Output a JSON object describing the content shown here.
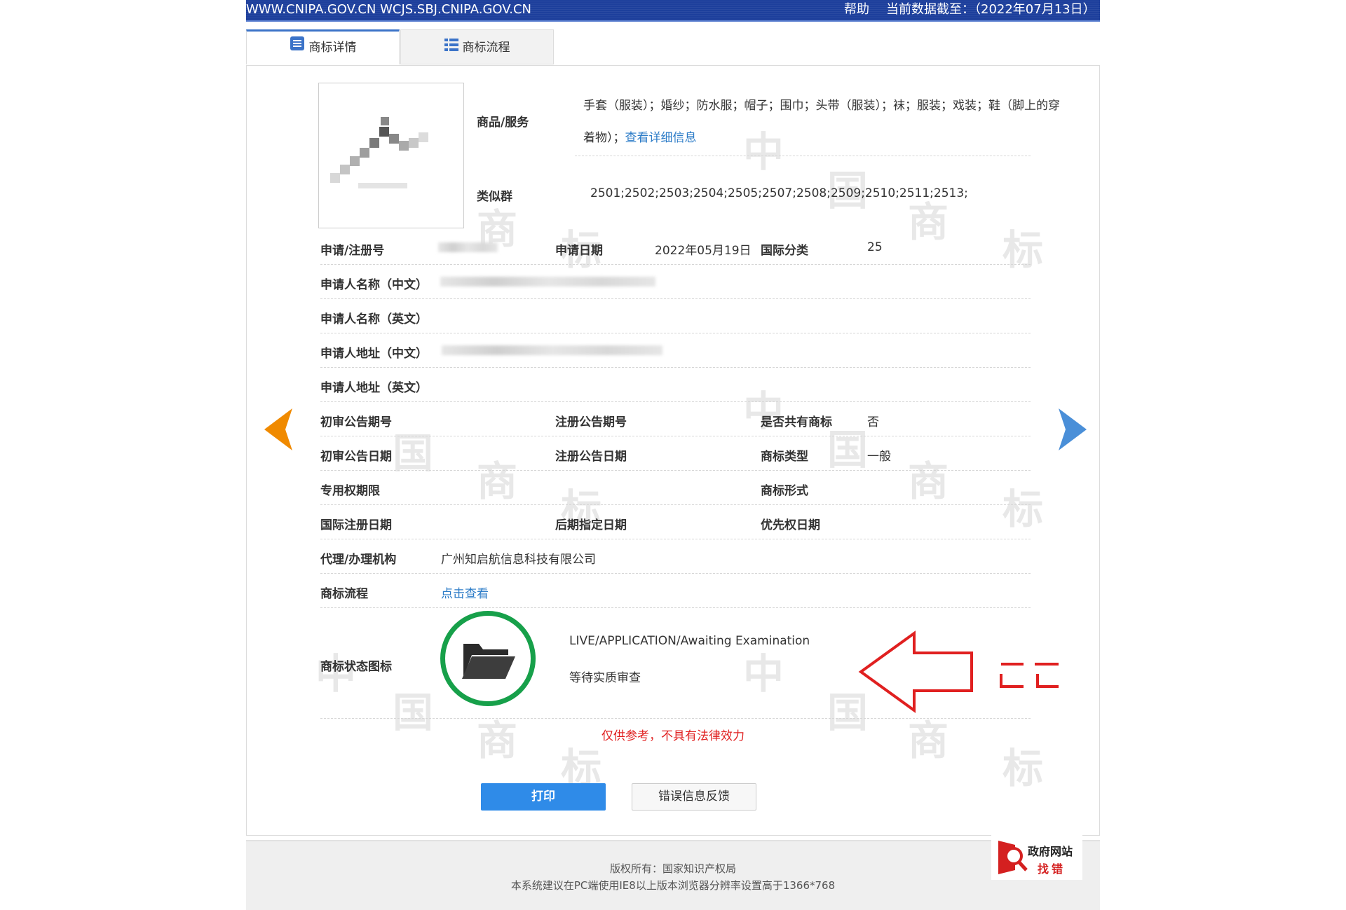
{
  "topbar": {
    "site": "WWW.CNIPA.GOV.CN WCJS.SBJ.CNIPA.GOV.CN",
    "help": "帮助",
    "date_label": "当前数据截至：（2022年07月13日）"
  },
  "tabs": [
    {
      "label": "商标详情",
      "active": true
    },
    {
      "label": "商标流程",
      "active": false
    }
  ],
  "watermark_chars": [
    "中",
    "国",
    "商",
    "标"
  ],
  "details": {
    "goods_label": "商品/服务",
    "goods_line1": "手套（服装）；婚纱；防水服；帽子；围巾；头带（服装）；袜；服装；戏装；鞋（脚上的穿",
    "goods_line2": "着物）；",
    "goods_link": "查看详细信息",
    "similar_label": "类似群",
    "similar_value": "2501;2502;2503;2504;2505;2507;2508;2509;2510;2511;2513;",
    "reg_no_label": "申请/注册号",
    "app_date_label": "申请日期",
    "app_date_value": "2022年05月19日",
    "intl_class_label": "国际分类",
    "intl_class_value": "25",
    "applicant_cn_label": "申请人名称（中文）",
    "applicant_en_label": "申请人名称（英文）",
    "address_cn_label": "申请人地址（中文）",
    "address_en_label": "申请人地址（英文）",
    "prelim_no_label": "初审公告期号",
    "reg_no_pub_label": "注册公告期号",
    "shared_label": "是否共有商标",
    "shared_value": "否",
    "prelim_date_label": "初审公告日期",
    "reg_date_label": "注册公告日期",
    "tm_type_label": "商标类型",
    "tm_type_value": "一般",
    "exclusive_label": "专用权期限",
    "tm_form_label": "商标形式",
    "intl_reg_date_label": "国际注册日期",
    "later_date_label": "后期指定日期",
    "priority_date_label": "优先权日期",
    "agent_label": "代理/办理机构",
    "agent_value": "广州知启航信息科技有限公司",
    "flow_label": "商标流程",
    "flow_link": "点击查看",
    "status_icon_label": "商标状态图标",
    "status_en": "LIVE/APPLICATION/Awaiting Examination",
    "status_cn": "等待实质审查"
  },
  "disclaimer": "仅供参考，不具有法律效力",
  "buttons": {
    "print": "打印",
    "feedback": "错误信息反馈"
  },
  "footer": {
    "copyright": "版权所有：国家知识产权局",
    "note": "本系统建议在PC端使用IE8以上版本浏览器分辨率设置高于1366*768"
  },
  "gov_badge": {
    "line1": "政府网站",
    "line2": "找错"
  },
  "colors": {
    "header": "#1d3f9c",
    "accent": "#2f8be8",
    "status_ring": "#17a04a",
    "annotation": "#e02020",
    "nav_left": "#f08a00",
    "nav_right": "#4a8fd8"
  },
  "icons": [
    "list-icon",
    "grid-list-icon",
    "left-arrow-icon",
    "right-arrow-icon",
    "folder-icon",
    "red-arrow-annotation",
    "search-icon"
  ]
}
